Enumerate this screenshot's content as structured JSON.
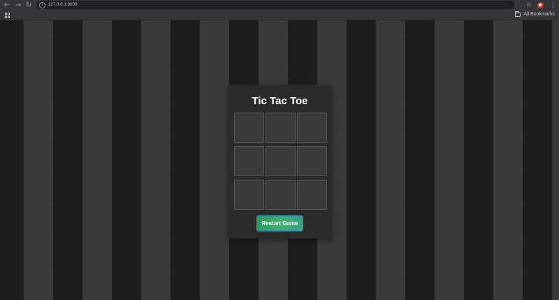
{
  "browser": {
    "url": "127.0.0.1:8000",
    "bookmarks_label": "All Bookmarks"
  },
  "game": {
    "title": "Tic Tac Toe",
    "cells": [
      "",
      "",
      "",
      "",
      "",
      "",
      "",
      "",
      ""
    ],
    "restart_label": "Restart Game"
  }
}
